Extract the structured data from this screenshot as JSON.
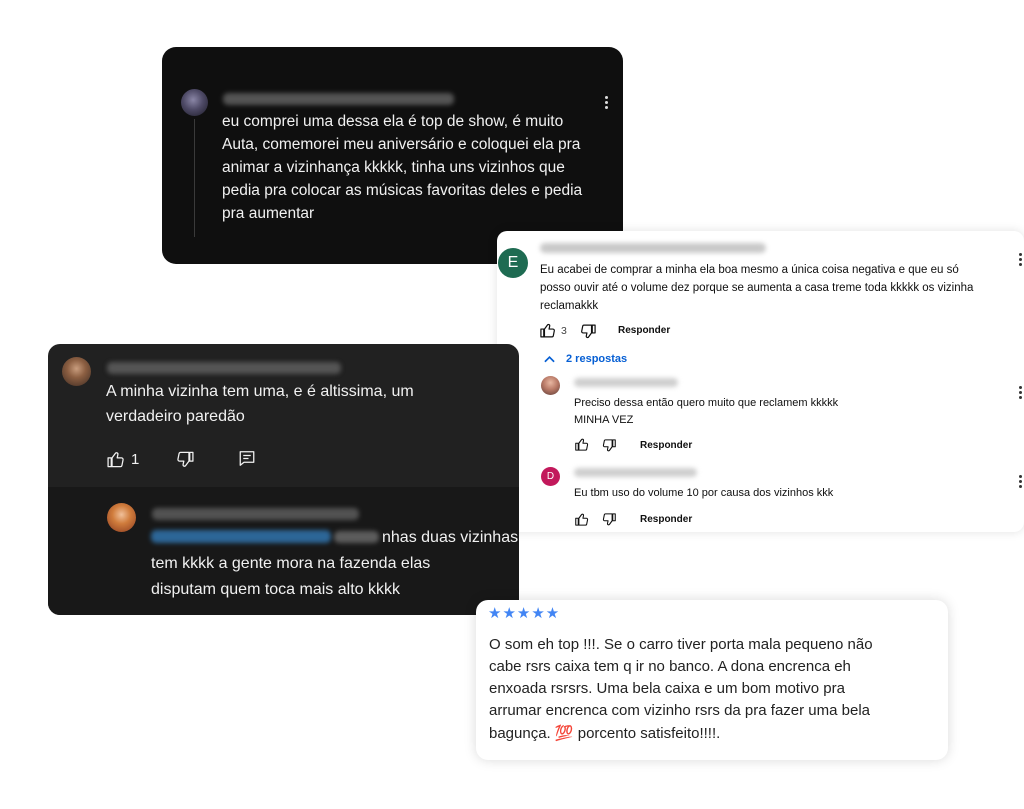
{
  "card1": {
    "comment": [
      "eu comprei uma dessa ela é top de show, é muito",
      "Auta, comemorei meu aniversário e coloquei ela pra",
      "animar a vizinhança kkkkk, tinha uns vizinhos que",
      "pedia pra colocar as músicas favoritas deles e pedia",
      "pra aumentar"
    ]
  },
  "card2": {
    "avatar_letter": "E",
    "comment": [
      "Eu acabei de comprar a minha ela boa mesmo a única coisa negativa e que eu só",
      "posso ouvir até o volume dez porque se aumenta a casa treme toda kkkkk os vizinha",
      "reclamakkk"
    ],
    "likes": "3",
    "reply_label": "Responder",
    "replies_toggle": "2 respostas",
    "replies": [
      {
        "avatar_letter": "",
        "comment": [
          "Preciso dessa então quero muito que reclamem kkkkk",
          "MINHA VEZ"
        ],
        "reply_label": "Responder"
      },
      {
        "avatar_letter": "D",
        "comment": [
          "Eu tbm uso do volume 10 por causa dos vizinhos kkk"
        ],
        "reply_label": "Responder"
      }
    ]
  },
  "card3": {
    "comment": [
      "A minha vizinha tem uma, e é altissima, um",
      "verdadeiro paredão"
    ],
    "likes": "1",
    "reply": {
      "comment": [
        "nhas duas vizinhas",
        "tem kkkk a gente mora na fazenda  elas",
        "disputam quem toca mais alto kkkk"
      ]
    }
  },
  "card4": {
    "stars": "★★★★★",
    "review": [
      "O som eh top !!!. Se o carro tiver porta mala pequeno não",
      "cabe rsrs caixa tem q ir no banco. A dona encrenca eh",
      "enxoada rsrsrs. Uma bela caixa e um bom motivo pra",
      "arrumar encrenca com vizinho rsrs da pra fazer uma bela",
      "bagunça. 💯 porcento satisfeito!!!!."
    ]
  },
  "colors": {
    "dark_bg": "#0f0f0f",
    "dark_card_bg": "#212121",
    "link_blue": "#065fd4",
    "star_blue": "#4285f4",
    "avatar_green": "#1e6b52",
    "avatar_pink": "#c2185b"
  }
}
